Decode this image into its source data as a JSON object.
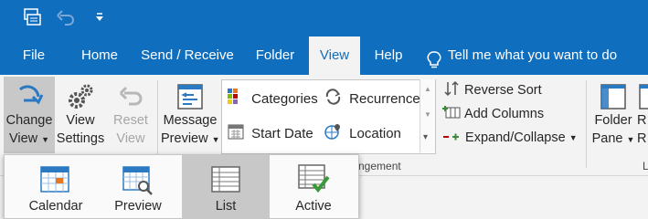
{
  "quick_access": {
    "icons": [
      "send-receive-all-folders-icon",
      "undo-icon",
      "customize-quick-access-toolbar-icon"
    ]
  },
  "tabs": [
    {
      "label": "File",
      "active": false
    },
    {
      "label": "Home",
      "active": false
    },
    {
      "label": "Send / Receive",
      "active": false
    },
    {
      "label": "Folder",
      "active": false
    },
    {
      "label": "View",
      "active": true
    },
    {
      "label": "Help",
      "active": false
    }
  ],
  "tell_me": "Tell me what you want to do",
  "ribbon": {
    "change_view": {
      "line1": "Change",
      "line2": "View"
    },
    "view_settings": {
      "line1": "View",
      "line2": "Settings"
    },
    "reset_view": {
      "line1": "Reset",
      "line2": "View"
    },
    "message_preview": {
      "line1": "Message",
      "line2": "Preview"
    },
    "arrangement": {
      "categories": "Categories",
      "recurrence": "Recurrence",
      "start_date": "Start Date",
      "location": "Location",
      "group_label": "ngement"
    },
    "reverse_sort": "Reverse Sort",
    "add_columns": "Add Columns",
    "expand_collapse": "Expand/Collapse",
    "folder_pane": {
      "line1": "Folder",
      "line2": "Pane"
    },
    "reading_pane_partial": {
      "line1": "R",
      "line2": "R"
    },
    "layout_partial": "L"
  },
  "change_view_menu": [
    {
      "label": "Calendar",
      "selected": false
    },
    {
      "label": "Preview",
      "selected": false
    },
    {
      "label": "List",
      "selected": true
    },
    {
      "label": "Active",
      "selected": false
    }
  ],
  "colors": {
    "title_bar": "#106ebe",
    "ribbon_bg": "#f3f3f3",
    "selected": "#c8c8c8",
    "accent_blue": "#2b79c2"
  }
}
